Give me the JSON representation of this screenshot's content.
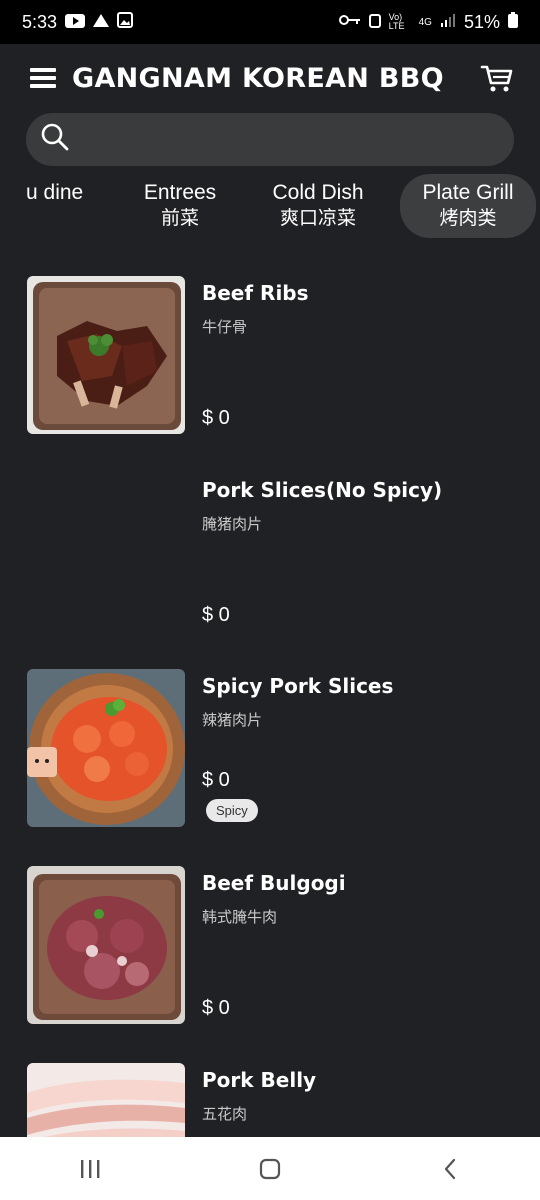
{
  "status_bar": {
    "time": "5:33",
    "network_label": "Vo) LTE",
    "network_gen": "4G",
    "battery": "51%"
  },
  "header": {
    "title": "GANGNAM KOREAN BBQ"
  },
  "search": {
    "placeholder": ""
  },
  "tabs": [
    {
      "en": "u dine",
      "zh": ""
    },
    {
      "en": "Entrees",
      "zh": "前菜"
    },
    {
      "en": "Cold Dish",
      "zh": "爽口凉菜"
    },
    {
      "en": "Plate Grill",
      "zh": "烤肉类",
      "active": true
    }
  ],
  "items": [
    {
      "name": "Beef Ribs",
      "zh": "牛仔骨",
      "price": "$ 0",
      "image": "beef-ribs"
    },
    {
      "name": "Pork Slices(No Spicy)",
      "zh": "腌猪肉片",
      "price": "$ 0",
      "image": ""
    },
    {
      "name": "Spicy Pork Slices",
      "zh": "辣猪肉片",
      "price": "$ 0",
      "badge": "Spicy",
      "image": "spicy-pork"
    },
    {
      "name": "Beef Bulgogi",
      "zh": "韩式腌牛肉",
      "price": "$ 0",
      "image": "beef-bulgogi"
    },
    {
      "name": "Pork Belly",
      "zh": "五花肉",
      "price": "",
      "image": "pork-belly"
    }
  ],
  "icons": {
    "menu": "hamburger-menu-icon",
    "cart": "shopping-cart-icon",
    "search": "search-icon",
    "nav_recents": "recent-apps-icon",
    "nav_home": "home-icon",
    "nav_back": "back-icon"
  }
}
